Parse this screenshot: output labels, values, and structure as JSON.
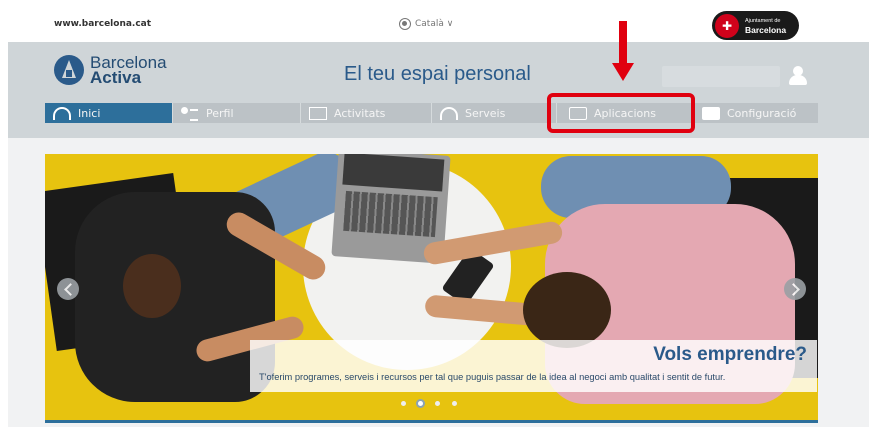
{
  "top": {
    "site_url": "www.barcelona.cat",
    "language": "Català ∨",
    "city_logo_small": "Ajuntament de",
    "city_logo_big": "Barcelona"
  },
  "header": {
    "brand_line1": "Barcelona",
    "brand_line2": "Activa",
    "title": "El teu espai personal"
  },
  "nav": {
    "items": [
      {
        "label": "Inici",
        "icon": "gauge-icon",
        "active": true
      },
      {
        "label": "Perfil",
        "icon": "person-icon",
        "active": false
      },
      {
        "label": "Activitats",
        "icon": "calendar-icon",
        "active": false
      },
      {
        "label": "Serveis",
        "icon": "headset-icon",
        "active": false
      },
      {
        "label": "Aplicacions",
        "icon": "mobile-icon",
        "active": false
      },
      {
        "label": "Configuració",
        "icon": "config-icon",
        "active": false
      }
    ]
  },
  "annotation": {
    "highlighted_item": "Aplicacions",
    "color": "#e0000f"
  },
  "hero": {
    "title": "Vols emprendre?",
    "text": "T'oferim programes, serveis i recursos per tal que puguis passar de la idea al negoci amb qualitat i sentit de futur.",
    "slides": 4,
    "active_slide": 2
  },
  "colors": {
    "brand_blue": "#2a5a8a",
    "nav_active": "#2d6f9b",
    "nav_inactive": "#bcc2c6",
    "hero_yellow": "#e7c30f"
  }
}
